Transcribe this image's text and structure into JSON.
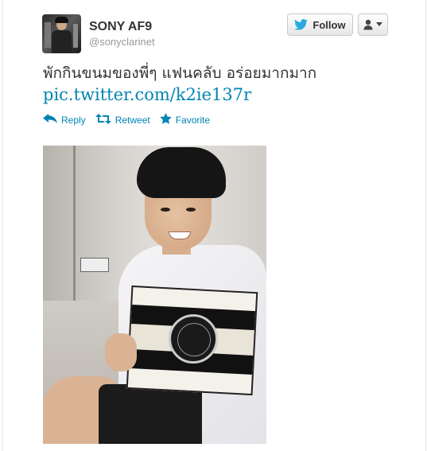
{
  "profile": {
    "name": "SONY AF9",
    "handle": "@sonyclarinet"
  },
  "buttons": {
    "follow_label": "Follow"
  },
  "tweet": {
    "text": "พักกินขนมของพี่ๆ แฟนคลับ อร่อยมากมาก",
    "link": "pic.twitter.com/k2ie137r"
  },
  "actions": {
    "reply": "Reply",
    "retweet": "Retweet",
    "favorite": "Favorite"
  },
  "colors": {
    "link": "#0084b4",
    "text": "#333333",
    "muted": "#999999"
  }
}
